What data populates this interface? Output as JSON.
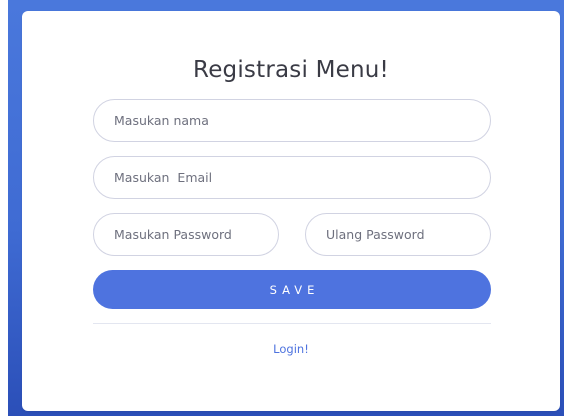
{
  "form": {
    "title": "Registrasi Menu!",
    "name_placeholder": "Masukan nama",
    "email_placeholder": "Masukan  Email",
    "password_placeholder": "Masukan Password",
    "repeat_password_placeholder": "Ulang Password",
    "save_label": "SAVE",
    "login_link": "Login!"
  },
  "colors": {
    "primary": "#4e73df",
    "background_gradient_top": "#4a78dc",
    "background_gradient_bottom": "#2b4fb8",
    "card": "#ffffff",
    "input_border": "#d1d3e2",
    "title_text": "#3a3b45"
  }
}
